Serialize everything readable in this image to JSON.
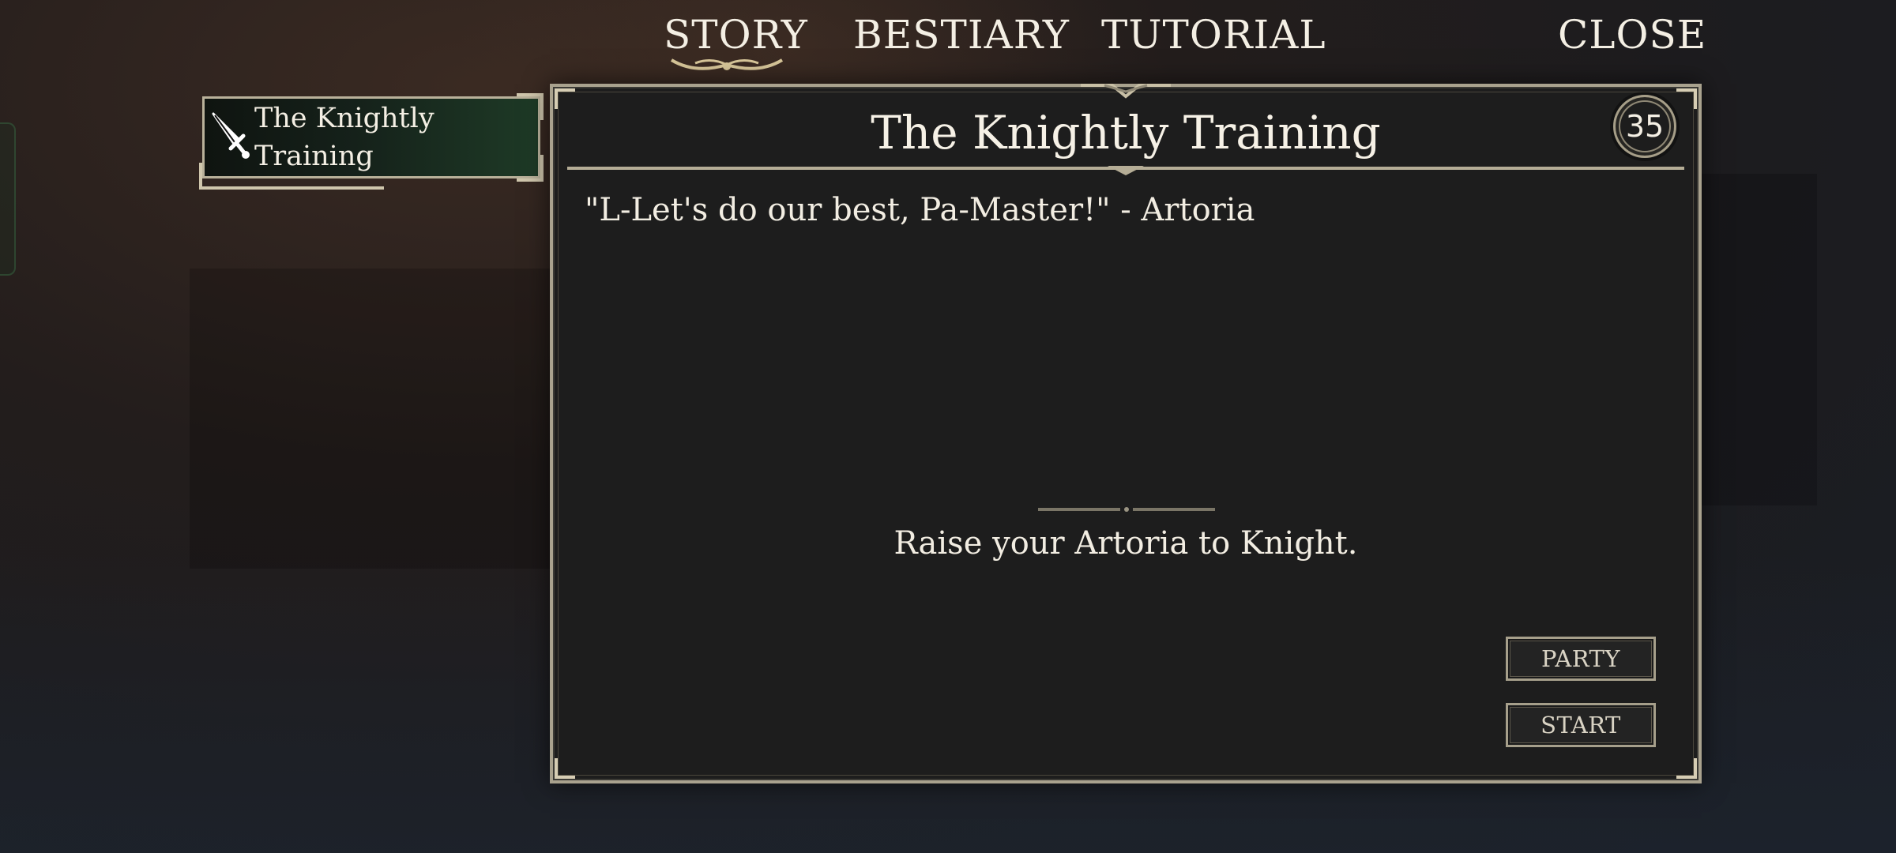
{
  "nav": {
    "story": "STORY",
    "bestiary": "BESTIARY",
    "tutorial": "TUTORIAL",
    "close": "CLOSE",
    "active": "story"
  },
  "quest_list": {
    "items": [
      {
        "label": "The Knightly Training",
        "icon": "sword-icon",
        "selected": true
      }
    ]
  },
  "quest": {
    "title": "The Knightly Training",
    "level": "35",
    "quote": "\"L-Let's do our best, Pa-Master!\" - Artoria",
    "objective": "Raise your Artoria to Knight."
  },
  "buttons": {
    "party": "PARTY",
    "start": "START"
  },
  "colors": {
    "text": "#f4efe4",
    "panel_bg": "#1d1d1d",
    "frame": "#a9a28e",
    "selected_item_accent": "#1e3a26"
  }
}
